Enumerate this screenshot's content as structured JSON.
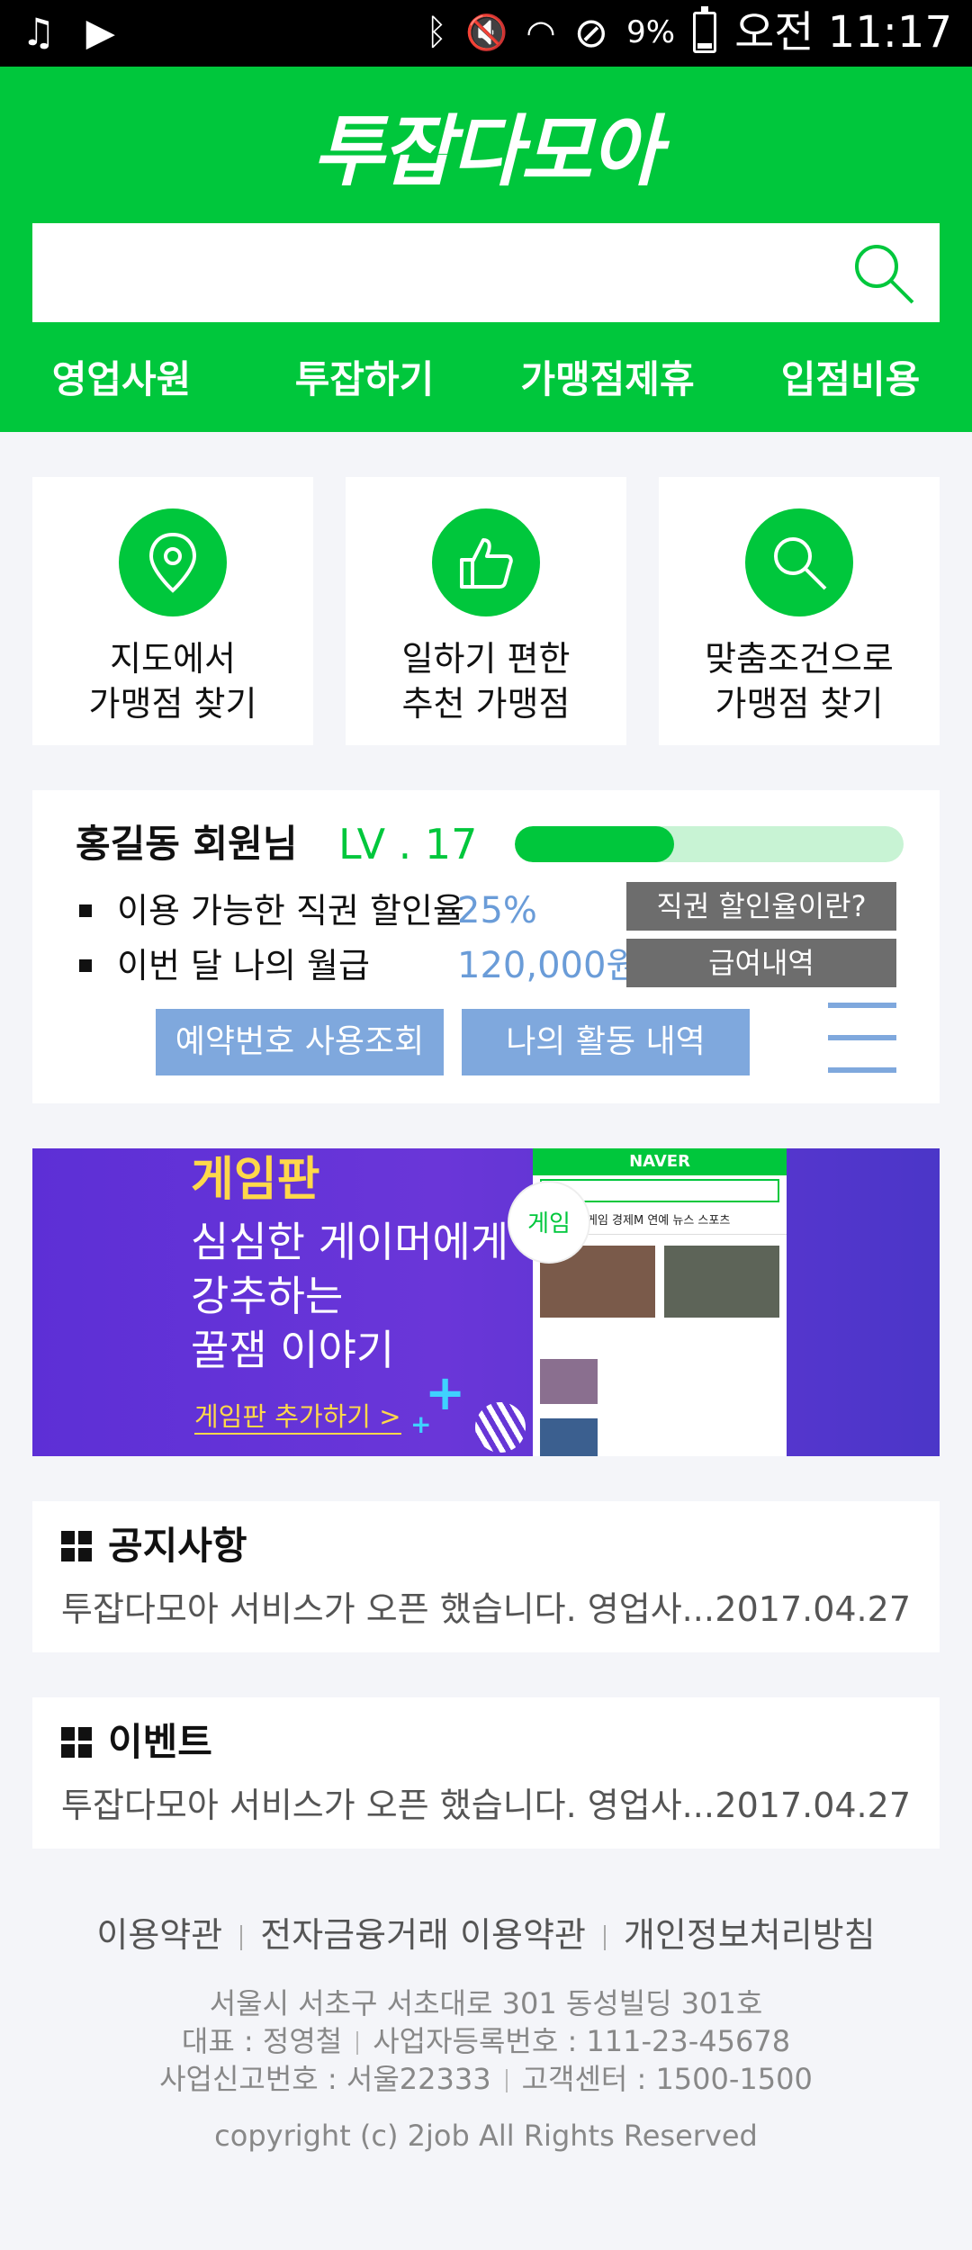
{
  "status_bar": {
    "battery": "9%",
    "time": "오전 11:17"
  },
  "header": {
    "logo": "투잡다모아",
    "search_placeholder": "",
    "nav": [
      "영업사원",
      "투잡하기",
      "가맹점제휴",
      "입점비용"
    ]
  },
  "quick_menu": [
    {
      "line1": "지도에서",
      "line2": "가맹점 찾기",
      "icon": "map-pin-icon"
    },
    {
      "line1": "일하기 편한",
      "line2": "추천 가맹점",
      "icon": "thumbs-up-icon"
    },
    {
      "line1": "맞춤조건으로",
      "line2": "가맹점 찾기",
      "icon": "search-icon"
    }
  ],
  "member": {
    "name": "홍길동 회원님",
    "level": "LV . 17",
    "level_progress": 0.41,
    "discount_label": "이용 가능한 직권 할인율",
    "discount_value": "25%",
    "discount_button": "직권 할인율이란?",
    "salary_label": "이번 달 나의 월급",
    "salary_value": "120,000원",
    "salary_button": "급여내역",
    "reservation_button": "예약번호 사용조회",
    "activity_button": "나의 활동 내역"
  },
  "banner": {
    "title": "게임판",
    "subtitle": "심심한 게이머에게\n강추하는\n꿀잼 이야기",
    "link": "게임판 추가하기 >",
    "phone_header": "NAVER",
    "phone_tabs": "게임 경제M 연예 뉴스 스포츠",
    "bubble": "게임"
  },
  "notice": {
    "title": "공지사항",
    "text": "투잡다모아 서비스가 오픈 했습니다. 영업사...",
    "date": "2017.04.27"
  },
  "event": {
    "title": "이벤트",
    "text": "투잡다모아 서비스가 오픈 했습니다. 영업사...",
    "date": "2017.04.27"
  },
  "footer": {
    "links": [
      "이용약관",
      "전자금융거래 이용약관",
      "개인정보처리방침"
    ],
    "address": "서울시 서초구 서초대로 301 동성빌딩 301호",
    "ceo": "대표 : 정영철",
    "biz_no": "사업자등록번호 : 111-23-45678",
    "report_no": "사업신고번호 : 서울22333",
    "cs": "고객센터 : 1500-1500",
    "copyright": "copyright (c) 2job  All Rights Reserved"
  },
  "colors": {
    "brand_green": "#00c73c",
    "accent_blue": "#7fa8dd",
    "gray_button": "#6d6d6d"
  }
}
